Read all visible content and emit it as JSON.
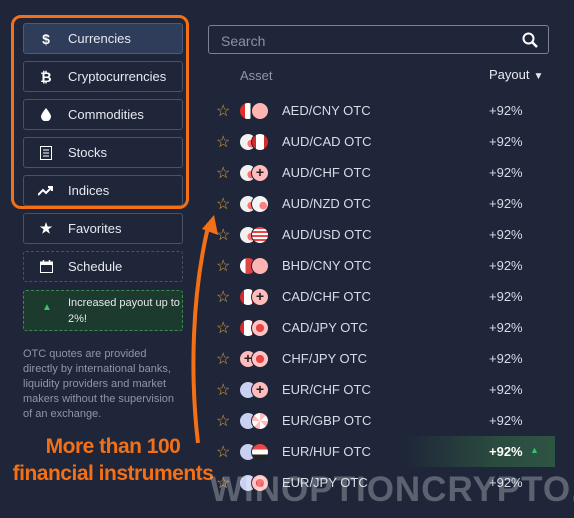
{
  "sidebar": {
    "items": [
      {
        "label": "Currencies",
        "icon": "dollar-icon",
        "glyph": "$",
        "active": true
      },
      {
        "label": "Cryptocurrencies",
        "icon": "bitcoin-icon",
        "glyph": "₿",
        "active": false
      },
      {
        "label": "Commodities",
        "icon": "drop-icon",
        "glyph": "●",
        "active": false
      },
      {
        "label": "Stocks",
        "icon": "document-icon",
        "glyph": "▤",
        "active": false
      },
      {
        "label": "Indices",
        "icon": "trend-up-icon",
        "glyph": "↗",
        "active": false
      }
    ],
    "favorites_label": "Favorites",
    "schedule_label": "Schedule",
    "promo_text": "Increased payout up to 2%!",
    "otc_note": "OTC quotes are provided directly by international banks, liquidity providers and market makers without the supervision of an exchange."
  },
  "callout": {
    "line1": "More than 100",
    "line2": "financial instruments"
  },
  "search": {
    "placeholder": "Search"
  },
  "table": {
    "asset_header": "Asset",
    "payout_header": "Payout",
    "rows": [
      {
        "asset": "AED/CNY OTC",
        "payout": "+92%"
      },
      {
        "asset": "AUD/CAD OTC",
        "payout": "+92%"
      },
      {
        "asset": "AUD/CHF OTC",
        "payout": "+92%"
      },
      {
        "asset": "AUD/NZD OTC",
        "payout": "+92%"
      },
      {
        "asset": "AUD/USD OTC",
        "payout": "+92%"
      },
      {
        "asset": "BHD/CNY OTC",
        "payout": "+92%"
      },
      {
        "asset": "CAD/CHF OTC",
        "payout": "+92%"
      },
      {
        "asset": "CAD/JPY OTC",
        "payout": "+92%"
      },
      {
        "asset": "CHF/JPY OTC",
        "payout": "+92%"
      },
      {
        "asset": "EUR/CHF OTC",
        "payout": "+92%"
      },
      {
        "asset": "EUR/GBP OTC",
        "payout": "+92%"
      },
      {
        "asset": "EUR/HUF OTC",
        "payout": "+92%",
        "selected": true
      },
      {
        "asset": "EUR/JPY OTC",
        "payout": "+92%"
      }
    ]
  },
  "watermark": "WINOPTIONCRYPTO.COM",
  "colors": {
    "accent_orange": "#f37016",
    "star": "#d9a13f",
    "positive": "#35c36b",
    "background": "#1f2639"
  }
}
